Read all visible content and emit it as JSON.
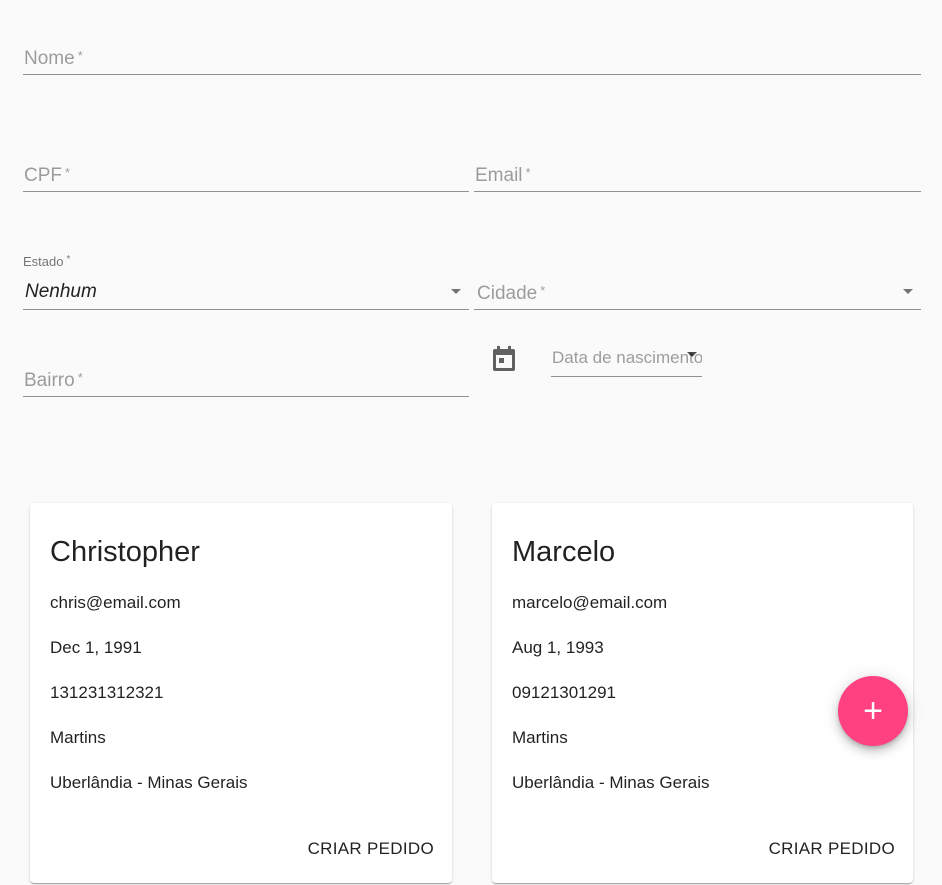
{
  "form": {
    "nome": {
      "label": "Nome",
      "required_mark": "*"
    },
    "cpf": {
      "label": "CPF",
      "required_mark": "*"
    },
    "email": {
      "label": "Email",
      "required_mark": "*"
    },
    "estado": {
      "label": "Estado",
      "required_mark": "*",
      "value": "Nenhum"
    },
    "cidade": {
      "label": "Cidade",
      "required_mark": "*"
    },
    "bairro": {
      "label": "Bairro",
      "required_mark": "*"
    },
    "data_nascimento": {
      "placeholder": "Data de nascimento"
    }
  },
  "cards": [
    {
      "name": "Christopher",
      "email": "chris@email.com",
      "birth": "Dec 1, 1991",
      "cpf": "131231312321",
      "bairro": "Martins",
      "location": "Uberlândia - Minas Gerais",
      "action": "CRIAR PEDIDO"
    },
    {
      "name": "Marcelo",
      "email": "marcelo@email.com",
      "birth": "Aug 1, 1993",
      "cpf": "09121301291",
      "bairro": "Martins",
      "location": "Uberlândia - Minas Gerais",
      "action": "CRIAR PEDIDO"
    }
  ],
  "fab": {
    "symbol": "+",
    "icon": "add-icon"
  },
  "colors": {
    "accent": "#ff4081",
    "background": "#fafafa"
  }
}
